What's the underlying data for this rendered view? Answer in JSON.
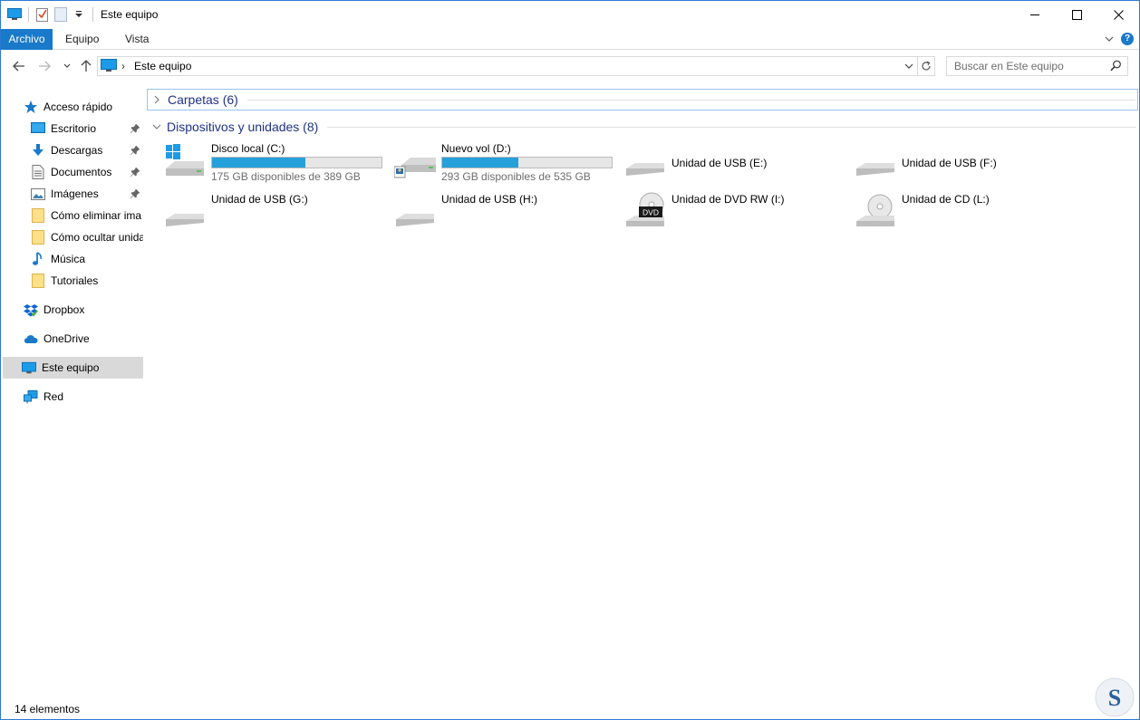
{
  "window": {
    "title": "Este equipo",
    "accent_color": "#1979ca"
  },
  "ribbon": {
    "tabs": [
      "Archivo",
      "Equipo",
      "Vista"
    ],
    "help_label": "?"
  },
  "address_bar": {
    "breadcrumb": "Este equipo",
    "search_placeholder": "Buscar en Este equipo"
  },
  "sidebar": {
    "quick_access": {
      "label": "Acceso rápido",
      "items": [
        {
          "label": "Escritorio",
          "icon": "desktop-icon",
          "pinned": true
        },
        {
          "label": "Descargas",
          "icon": "download-icon",
          "pinned": true
        },
        {
          "label": "Documentos",
          "icon": "documents-icon",
          "pinned": true
        },
        {
          "label": "Imágenes",
          "icon": "pictures-icon",
          "pinned": true
        },
        {
          "label": "Cómo eliminar ima",
          "icon": "folder-icon",
          "pinned": false
        },
        {
          "label": "Cómo ocultar unida",
          "icon": "folder-icon",
          "pinned": false
        },
        {
          "label": "Música",
          "icon": "music-icon",
          "pinned": false
        },
        {
          "label": "Tutoriales",
          "icon": "folder-icon",
          "pinned": false
        }
      ]
    },
    "locations": [
      {
        "label": "Dropbox",
        "icon": "dropbox-icon"
      },
      {
        "label": "OneDrive",
        "icon": "onedrive-icon"
      },
      {
        "label": "Este equipo",
        "icon": "computer-icon",
        "selected": true
      },
      {
        "label": "Red",
        "icon": "network-icon"
      }
    ]
  },
  "content": {
    "groups": [
      {
        "title": "Carpetas (6)",
        "expanded": false
      },
      {
        "title": "Dispositivos y unidades (8)",
        "expanded": true
      }
    ],
    "drives": [
      {
        "name": "Disco local (C:)",
        "free_text": "175 GB disponibles de 389 GB",
        "used_fraction": 0.55,
        "icon": "windows-drive-icon"
      },
      {
        "name": "Nuevo vol (D:)",
        "free_text": "293 GB disponibles de 535 GB",
        "used_fraction": 0.45,
        "icon": "hard-drive-icon"
      },
      {
        "name": "Unidad de USB (E:)",
        "icon": "usb-drive-icon"
      },
      {
        "name": "Unidad de USB (F:)",
        "icon": "usb-drive-icon"
      },
      {
        "name": "Unidad de USB (G:)",
        "icon": "usb-drive-icon"
      },
      {
        "name": "Unidad de USB (H:)",
        "icon": "usb-drive-icon"
      },
      {
        "name": "Unidad de DVD RW (I:)",
        "icon": "dvd-drive-icon",
        "badge": "DVD"
      },
      {
        "name": "Unidad de CD (L:)",
        "icon": "cd-drive-icon"
      }
    ]
  },
  "statusbar": {
    "count": "14 elementos"
  }
}
